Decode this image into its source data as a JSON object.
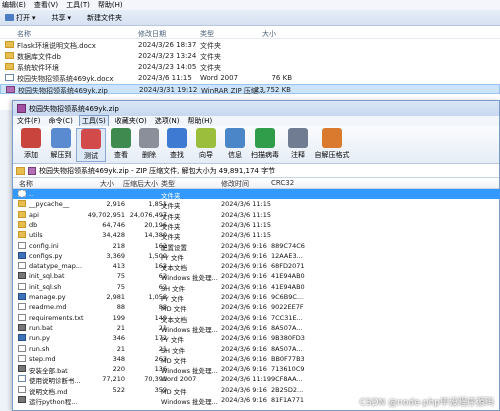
{
  "explorer": {
    "menu": [
      "编辑(E)",
      "查看(V)",
      "工具(T)",
      "帮助(H)"
    ],
    "toolbar": {
      "open_label": "打开",
      "share_label": "共享",
      "new_folder_label": "新建文件夹"
    },
    "columns": {
      "name": "名称",
      "date": "修改日期",
      "type": "类型",
      "size": "大小"
    },
    "files": [
      {
        "name": "Flask环境说明文档.docx",
        "date": "2024/3/26 18:37",
        "type": "文件夹",
        "size": "",
        "icon": "folder"
      },
      {
        "name": "数据库文件db",
        "date": "2024/3/23 13:24",
        "type": "文件夹",
        "size": "",
        "icon": "folder"
      },
      {
        "name": "系统软件环境",
        "date": "2024/3/23 14:05",
        "type": "文件夹",
        "size": "",
        "icon": "folder"
      },
      {
        "name": "校园失物招领系统469yk.docx",
        "date": "2024/3/6 11:15",
        "type": "Word 2007",
        "size": "76 KB",
        "icon": "doc"
      },
      {
        "name": "校园失物招领系统469yk.zip",
        "date": "2024/3/31 19:12",
        "type": "WinRAR ZIP 压缩...",
        "size": "23,752 KB",
        "icon": "zip",
        "selected": true
      }
    ]
  },
  "rar": {
    "title": "校园失物招领系统469yk.zip",
    "menu": [
      "文件(F)",
      "命令(C)",
      "工具(S)",
      "收藏夹(O)",
      "选项(N)",
      "帮助(H)"
    ],
    "active_menu_index": 2,
    "tools": [
      {
        "label": "添加",
        "icon": "add-icon",
        "color": "#c9443d"
      },
      {
        "label": "解压到",
        "icon": "extract-icon",
        "color": "#5a8bd1"
      },
      {
        "label": "测试",
        "icon": "test-icon",
        "color": "#d34a4a"
      },
      {
        "label": "查看",
        "icon": "view-icon",
        "color": "#3f8a4f"
      },
      {
        "label": "删除",
        "icon": "delete-icon",
        "color": "#8a8f99"
      },
      {
        "label": "查找",
        "icon": "find-icon",
        "color": "#3e7ad1"
      },
      {
        "label": "向导",
        "icon": "wizard-icon",
        "color": "#9bbf3d"
      },
      {
        "label": "信息",
        "icon": "info-icon",
        "color": "#4b86c9"
      },
      {
        "label": "扫描病毒",
        "icon": "virus-scan-icon",
        "color": "#2f9d4a"
      },
      {
        "label": "注释",
        "icon": "comment-icon",
        "color": "#6f7c92"
      },
      {
        "label": "自解压格式",
        "icon": "sfx-icon",
        "color": "#d97a2e"
      }
    ],
    "path": "校园失物招领系统469yk.zip - ZIP 压缩文件, 解包大小为 49,891,174 字节",
    "columns": {
      "name": "名称",
      "size": "大小",
      "packed": "压缩后大小",
      "type": "类型",
      "modified": "修改时间",
      "crc": "CRC32"
    },
    "rows": [
      {
        "name": "..",
        "size": "",
        "packed": "",
        "type": "文件夹",
        "modified": "",
        "crc": "",
        "icon": "up",
        "selected": true
      },
      {
        "name": "__pycache__",
        "size": "2,916",
        "packed": "1,851",
        "type": "文件夹",
        "modified": "2024/3/6 11:15",
        "crc": "",
        "icon": "folder"
      },
      {
        "name": "api",
        "size": "49,702,951",
        "packed": "24,076,497",
        "type": "文件夹",
        "modified": "2024/3/6 11:15",
        "crc": "",
        "icon": "folder"
      },
      {
        "name": "db",
        "size": "64,746",
        "packed": "20,196",
        "type": "文件夹",
        "modified": "2024/3/6 11:15",
        "crc": "",
        "icon": "folder"
      },
      {
        "name": "utils",
        "size": "34,428",
        "packed": "14,380",
        "type": "文件夹",
        "modified": "2024/3/6 11:15",
        "crc": "",
        "icon": "folder"
      },
      {
        "name": "config.ini",
        "size": "218",
        "packed": "162",
        "type": "配置设置",
        "modified": "2024/3/6 9:16",
        "crc": "889C74C6",
        "icon": "txt"
      },
      {
        "name": "configs.py",
        "size": "3,369",
        "packed": "1,500",
        "type": "PY 文件",
        "modified": "2024/3/6 9:16",
        "crc": "12AAE3...",
        "icon": "pyf"
      },
      {
        "name": "datatype_map...",
        "size": "413",
        "packed": "162",
        "type": "文本文档",
        "modified": "2024/3/6 9:16",
        "crc": "68FD2071",
        "icon": "txt"
      },
      {
        "name": "init_sql.bat",
        "size": "75",
        "packed": "62",
        "type": "Windows 批处理...",
        "modified": "2024/3/6 9:16",
        "crc": "41E94AB0",
        "icon": "bat"
      },
      {
        "name": "init_sql.sh",
        "size": "75",
        "packed": "62",
        "type": "SH 文件",
        "modified": "2024/3/6 9:16",
        "crc": "41E94AB0",
        "icon": "txt"
      },
      {
        "name": "manage.py",
        "size": "2,981",
        "packed": "1,058",
        "type": "PY 文件",
        "modified": "2024/3/6 9:16",
        "crc": "9C6B9C...",
        "icon": "pyf"
      },
      {
        "name": "readme.md",
        "size": "88",
        "packed": "88",
        "type": "MD 文件",
        "modified": "2024/3/6 9:16",
        "crc": "9022EE7F",
        "icon": "txt"
      },
      {
        "name": "requirements.txt",
        "size": "199",
        "packed": "149",
        "type": "文本文档",
        "modified": "2024/3/6 9:16",
        "crc": "7CC31E...",
        "icon": "txt"
      },
      {
        "name": "run.bat",
        "size": "21",
        "packed": "21",
        "type": "Windows 批处理...",
        "modified": "2024/3/6 9:16",
        "crc": "8A507A...",
        "icon": "bat"
      },
      {
        "name": "run.py",
        "size": "346",
        "packed": "172",
        "type": "PY 文件",
        "modified": "2024/3/6 9:16",
        "crc": "9B380FD3",
        "icon": "pyf"
      },
      {
        "name": "run.sh",
        "size": "21",
        "packed": "21",
        "type": "SH 文件",
        "modified": "2024/3/6 9:16",
        "crc": "8A507A...",
        "icon": "txt"
      },
      {
        "name": "step.md",
        "size": "348",
        "packed": "263",
        "type": "MD 文件",
        "modified": "2024/3/6 9:16",
        "crc": "BB0F77B3",
        "icon": "txt"
      },
      {
        "name": "安装全部.bat",
        "size": "220",
        "packed": "136",
        "type": "Windows 批处理...",
        "modified": "2024/3/6 9:16",
        "crc": "713610C9",
        "icon": "bat"
      },
      {
        "name": "使用说明诊断书...",
        "size": "77,210",
        "packed": "70,391",
        "type": "Word 2007",
        "modified": "2024/3/6 11:19",
        "crc": "9CF8AA...",
        "icon": "doc"
      },
      {
        "name": "说明文档.md",
        "size": "522",
        "packed": "359",
        "type": "MD 文件",
        "modified": "2024/3/6 9:16",
        "crc": "2B25D2...",
        "icon": "txt"
      },
      {
        "name": "运行python程...",
        "size": "",
        "packed": "",
        "type": "Windows 批处理...",
        "modified": "2024/3/6 9:16",
        "crc": "81F1A771",
        "icon": "bat"
      }
    ]
  },
  "watermark": "CSDN @node-php毕设程序源码"
}
